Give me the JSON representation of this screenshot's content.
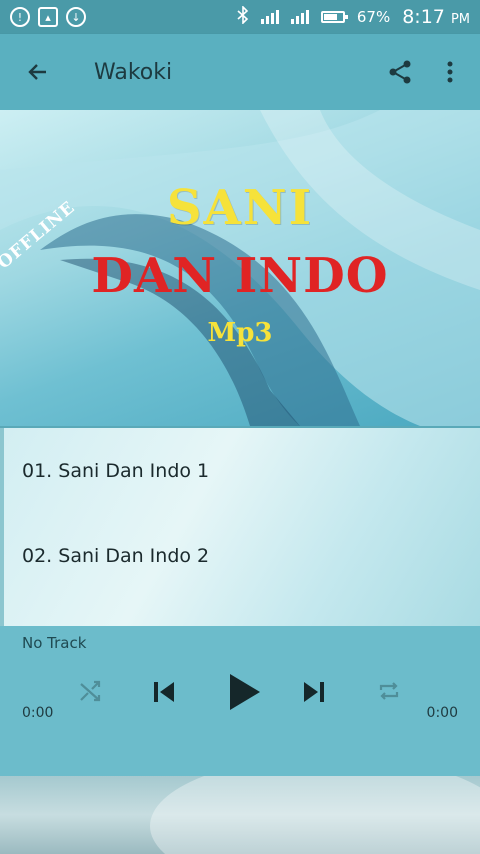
{
  "status_bar": {
    "battery": "67%",
    "time": "8:17",
    "ampm": "PM"
  },
  "app_bar": {
    "title": "Wakoki"
  },
  "banner": {
    "badge": "OFFLINE",
    "line1": "SANI",
    "line2": "DAN INDO",
    "line3": "Mp3"
  },
  "tracks": [
    {
      "label": "01. Sani Dan Indo 1"
    },
    {
      "label": "02. Sani Dan Indo 2"
    }
  ],
  "player": {
    "now_playing": "No Track",
    "elapsed": "0:00",
    "duration": "0:00"
  },
  "colors": {
    "status_bar": "#4a9aa8",
    "app_bar": "#5ab0c0",
    "player": "#6cbccb",
    "headline_yellow": "#f6e23a",
    "headline_red": "#e02424"
  }
}
